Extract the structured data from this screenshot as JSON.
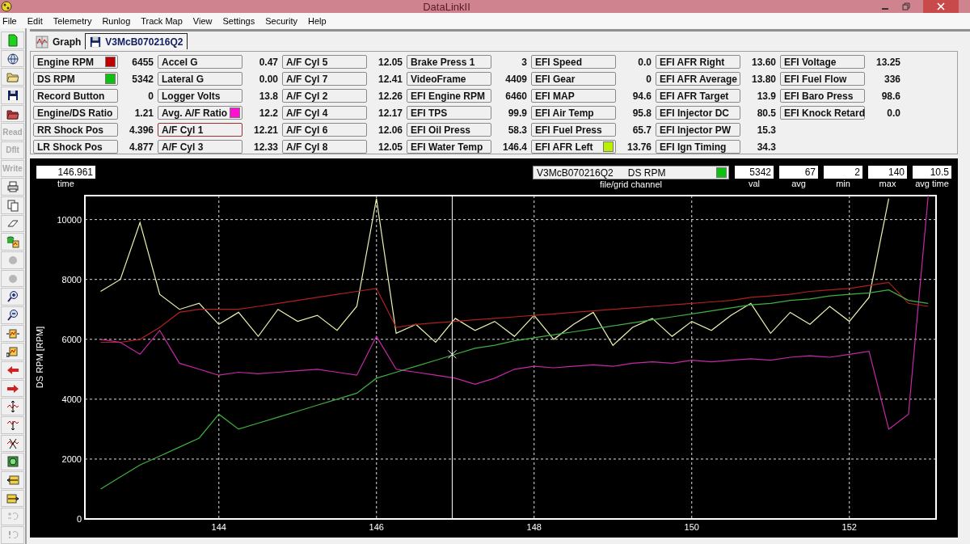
{
  "window": {
    "title": "DataLinkII"
  },
  "menu": [
    "File",
    "Edit",
    "Telemetry",
    "Runlog",
    "Track Map",
    "View",
    "Settings",
    "Security",
    "Help"
  ],
  "toolbar": [
    {
      "kind": "icon",
      "disabled": false
    },
    {
      "kind": "icon",
      "disabled": false
    },
    {
      "kind": "icon",
      "disabled": false
    },
    {
      "kind": "icon",
      "disabled": false
    },
    {
      "kind": "icon",
      "disabled": false
    },
    {
      "kind": "text",
      "label": "Read",
      "disabled": true
    },
    {
      "kind": "text",
      "label": "Dflt",
      "disabled": true
    },
    {
      "kind": "text",
      "label": "Write",
      "disabled": true
    },
    {
      "kind": "icon",
      "disabled": false
    },
    {
      "kind": "icon",
      "disabled": false
    },
    {
      "kind": "icon",
      "disabled": false
    },
    {
      "kind": "icon",
      "disabled": false
    },
    {
      "kind": "icon",
      "disabled": true
    },
    {
      "kind": "icon",
      "disabled": true
    },
    {
      "kind": "icon",
      "disabled": false
    },
    {
      "kind": "icon",
      "disabled": false
    },
    {
      "kind": "icon",
      "disabled": false
    },
    {
      "kind": "icon",
      "disabled": false
    },
    {
      "kind": "icon",
      "disabled": false
    },
    {
      "kind": "icon",
      "disabled": false
    },
    {
      "kind": "icon",
      "disabled": false
    },
    {
      "kind": "icon",
      "disabled": false
    },
    {
      "kind": "icon",
      "disabled": false
    },
    {
      "kind": "icon",
      "disabled": false
    },
    {
      "kind": "icon",
      "disabled": false
    },
    {
      "kind": "icon",
      "disabled": false
    },
    {
      "kind": "icon",
      "disabled": true
    },
    {
      "kind": "icon",
      "disabled": true
    }
  ],
  "tabs": [
    {
      "label": "Graph",
      "selected": false
    },
    {
      "label": "V3McB070216Q2",
      "selected": true
    }
  ],
  "channels": [
    {
      "label": "Engine RPM",
      "value": "6455",
      "color": "#c00000",
      "selected": false
    },
    {
      "label": "DS RPM",
      "value": "5342",
      "color": "#10c010",
      "selected": false
    },
    {
      "label": "Record Button",
      "value": "0",
      "selected": false
    },
    {
      "label": "Engine/DS Ratio",
      "value": "1.21",
      "selected": false
    },
    {
      "label": "RR Shock Pos",
      "value": "4.396",
      "selected": false
    },
    {
      "label": "LR Shock Pos",
      "value": "4.877",
      "selected": false
    },
    {
      "label": "Accel G",
      "value": "0.47",
      "selected": false
    },
    {
      "label": "Lateral G",
      "value": "0.00",
      "selected": false
    },
    {
      "label": "Logger Volts",
      "value": "13.8",
      "selected": false
    },
    {
      "label": "Avg. A/F Ratio",
      "value": "12.2",
      "color": "#ff10d0",
      "selected": false
    },
    {
      "label": "A/F Cyl 1",
      "value": "12.21",
      "selected": true
    },
    {
      "label": "A/F Cyl 3",
      "value": "12.33",
      "selected": false
    },
    {
      "label": "A/F Cyl 5",
      "value": "12.05",
      "selected": false
    },
    {
      "label": "A/F Cyl 7",
      "value": "12.41",
      "selected": false
    },
    {
      "label": "A/F Cyl 2",
      "value": "12.26",
      "selected": false
    },
    {
      "label": "A/F Cyl 4",
      "value": "12.17",
      "selected": false
    },
    {
      "label": "A/F Cyl 6",
      "value": "12.06",
      "selected": false
    },
    {
      "label": "A/F Cyl 8",
      "value": "12.05",
      "selected": false
    },
    {
      "label": "Brake Press 1",
      "value": "3",
      "selected": false
    },
    {
      "label": "VideoFrame",
      "value": "4409",
      "selected": false
    },
    {
      "label": "EFI Engine RPM",
      "value": "6460",
      "selected": false
    },
    {
      "label": "EFI TPS",
      "value": "99.9",
      "selected": false
    },
    {
      "label": "EFI Oil Press",
      "value": "58.3",
      "selected": false
    },
    {
      "label": "EFI Water Temp",
      "value": "146.4",
      "selected": false
    },
    {
      "label": "EFI Speed",
      "value": "0.0",
      "selected": false
    },
    {
      "label": "EFI Gear",
      "value": "0",
      "selected": false
    },
    {
      "label": "EFI MAP",
      "value": "94.6",
      "selected": false
    },
    {
      "label": "EFI Air Temp",
      "value": "95.8",
      "selected": false
    },
    {
      "label": "EFI Fuel Press",
      "value": "65.7",
      "selected": false
    },
    {
      "label": "EFI AFR Left",
      "value": "13.76",
      "color": "#b8f000",
      "selected": false
    },
    {
      "label": "EFI AFR Right",
      "value": "13.60",
      "selected": false
    },
    {
      "label": "EFI AFR Average",
      "value": "13.80",
      "selected": false
    },
    {
      "label": "EFI AFR Target",
      "value": "13.9",
      "selected": false
    },
    {
      "label": "EFI Injector DC",
      "value": "80.5",
      "selected": false
    },
    {
      "label": "EFI Injector PW",
      "value": "15.3",
      "selected": false
    },
    {
      "label": "EFI Ign Timing",
      "value": "34.3",
      "selected": false
    },
    {
      "label": "EFI Voltage",
      "value": "13.25",
      "selected": false
    },
    {
      "label": "EFI Fuel Flow",
      "value": "336",
      "selected": false
    },
    {
      "label": "EFI Baro Press",
      "value": "98.6",
      "selected": false
    },
    {
      "label": "EFI Knock Retard",
      "value": "0.0",
      "selected": false
    }
  ],
  "plot": {
    "time": "146.961",
    "time_label": "time",
    "channel_field": {
      "file": "V3McB070216Q2",
      "channel": "DS RPM",
      "color": "#10c010"
    },
    "channel_label": "file/grid channel",
    "stats": [
      {
        "label": "val",
        "value": "5342"
      },
      {
        "label": "avg",
        "value": "67"
      },
      {
        "label": "min",
        "value": "2"
      },
      {
        "label": "max",
        "value": "140"
      },
      {
        "label": "avg time",
        "value": "10.5"
      }
    ],
    "chart_data": {
      "type": "line",
      "ylabel": "DS RPM [RPM]",
      "xlim": [
        142.3,
        153.1
      ],
      "ylim": [
        0,
        10800
      ],
      "xticks": [
        144,
        146,
        148,
        150,
        152
      ],
      "yticks": [
        0,
        2000,
        4000,
        6000,
        8000,
        10000
      ],
      "x": [
        142.5,
        142.75,
        143,
        143.25,
        143.5,
        143.75,
        144,
        144.25,
        144.5,
        144.75,
        145,
        145.25,
        145.5,
        145.75,
        146,
        146.25,
        146.5,
        146.75,
        147,
        147.25,
        147.5,
        147.75,
        148,
        148.25,
        148.5,
        148.75,
        149,
        149.25,
        149.5,
        149.75,
        150,
        150.25,
        150.5,
        150.75,
        151,
        151.25,
        151.5,
        151.75,
        152,
        152.25,
        152.5,
        152.75,
        153
      ],
      "series": [
        {
          "color": "#e8f4b0",
          "values": [
            7600,
            8000,
            9900,
            7500,
            7000,
            7200,
            6500,
            6900,
            6100,
            7000,
            6600,
            6800,
            6300,
            7100,
            10700,
            6200,
            6500,
            5900,
            6700,
            6300,
            6600,
            6100,
            6800,
            6000,
            6500,
            6900,
            5800,
            6400,
            6700,
            6100,
            6600,
            6300,
            6800,
            7200,
            6200,
            6900,
            6500,
            7100,
            6600,
            7400,
            10700,
            null,
            null
          ]
        },
        {
          "color": "#b02020",
          "values": [
            5900,
            5900,
            6000,
            6400,
            6900,
            7000,
            7000,
            7000,
            7100,
            7200,
            7300,
            7400,
            7500,
            7600,
            7700,
            6400,
            6500,
            6550,
            6600,
            6650,
            6700,
            6750,
            6800,
            6850,
            6900,
            6950,
            7000,
            7050,
            7100,
            7150,
            7200,
            7250,
            7300,
            7400,
            7450,
            7500,
            7600,
            7650,
            7700,
            7800,
            7900,
            7200,
            7100
          ]
        },
        {
          "color": "#c828a8",
          "values": [
            6000,
            5900,
            5500,
            6300,
            5200,
            5000,
            4800,
            4900,
            4850,
            4900,
            4950,
            5000,
            4900,
            4800,
            6100,
            5000,
            4900,
            4800,
            4700,
            4500,
            4700,
            5000,
            5100,
            5050,
            5100,
            5150,
            5100,
            5200,
            5250,
            5200,
            5300,
            5250,
            5300,
            5350,
            5300,
            5400,
            5450,
            5400,
            5500,
            5600,
            3000,
            3500,
            10800
          ]
        },
        {
          "color": "#40b040",
          "values": [
            1000,
            1400,
            1800,
            2100,
            2400,
            2700,
            3500,
            3000,
            3200,
            3400,
            3600,
            3800,
            4000,
            4200,
            4700,
            4900,
            5100,
            5300,
            5500,
            5700,
            5800,
            5950,
            6050,
            6150,
            6250,
            6350,
            6450,
            6550,
            6650,
            6750,
            6850,
            6950,
            7050,
            7150,
            7200,
            7300,
            7350,
            7450,
            7500,
            7550,
            7650,
            7300,
            7200
          ]
        }
      ],
      "grid": true,
      "ref_lines": [
        {
          "axis": "x",
          "value": 146.961
        }
      ]
    }
  }
}
